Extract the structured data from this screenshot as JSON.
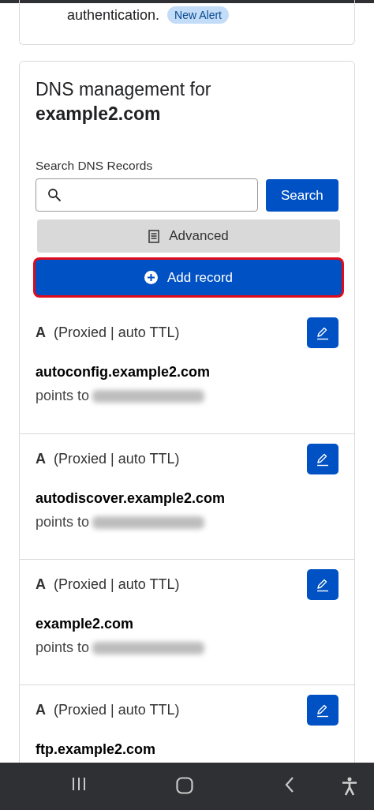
{
  "alert_card": {
    "text": "authentication.",
    "badge": "New Alert"
  },
  "dns_card": {
    "title": "DNS management for",
    "domain": "example2.com",
    "search": {
      "label": "Search DNS Records",
      "button": "Search"
    },
    "advanced_button": "Advanced",
    "add_button": {
      "label": "Add record",
      "highlighted": true
    },
    "records": [
      {
        "type": "A",
        "details": "(Proxied | auto TTL)",
        "name": "autoconfig.example2.com",
        "points_label": "points to",
        "address_blurred": true
      },
      {
        "type": "A",
        "details": "(Proxied | auto TTL)",
        "name": "autodiscover.example2.com",
        "points_label": "points to",
        "address_blurred": true
      },
      {
        "type": "A",
        "details": "(Proxied | auto TTL)",
        "name": "example2.com",
        "points_label": "points to",
        "address_blurred": true
      },
      {
        "type": "A",
        "details": "(Proxied | auto TTL)",
        "name": "ftp.example2.com"
      }
    ]
  },
  "nav_bar": {
    "buttons": [
      {
        "kind": "recents"
      },
      {
        "kind": "home"
      },
      {
        "kind": "back"
      },
      {
        "kind": "accessibility"
      }
    ]
  }
}
